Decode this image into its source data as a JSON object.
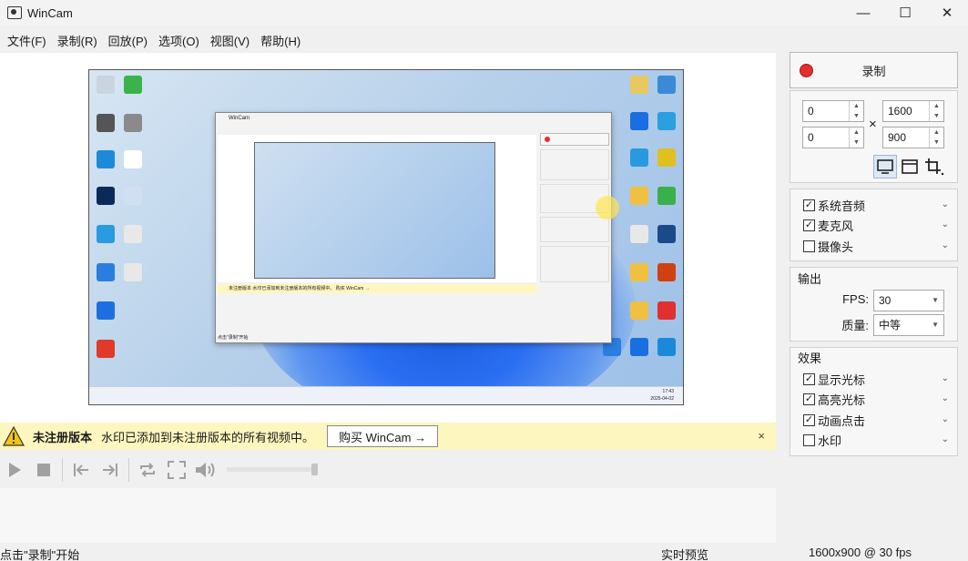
{
  "window": {
    "title": "WinCam",
    "min": "—",
    "max": "☐",
    "close": "✕"
  },
  "menu": [
    "文件(F)",
    "录制(R)",
    "回放(P)",
    "选项(O)",
    "视图(V)",
    "帮助(H)"
  ],
  "preview": {
    "inner_title": "WinCam",
    "inner_banner": "未注册版本  水印已添加到未注册版本的所有视频中。 购买 WinCam →",
    "inner_status": "点击\"录制\"开始",
    "taskbar_time": "17:43",
    "taskbar_date": "2025-04-02"
  },
  "banner": {
    "title": "未注册版本",
    "message": "水印已添加到未注册版本的所有视频中。",
    "buy_label": "购买 WinCam →",
    "close": "×"
  },
  "record": {
    "label": "录制"
  },
  "region": {
    "x": "0",
    "y": "0",
    "width": "1600",
    "height": "900",
    "times": "×"
  },
  "audio": [
    {
      "label": "系统音频",
      "checked": true
    },
    {
      "label": "麦克风",
      "checked": true
    },
    {
      "label": "摄像头",
      "checked": false
    }
  ],
  "output": {
    "title": "输出",
    "fps_label": "FPS:",
    "fps_value": "30",
    "quality_label": "质量:",
    "quality_value": "中等"
  },
  "effects": {
    "title": "效果",
    "items": [
      {
        "label": "显示光标",
        "checked": true
      },
      {
        "label": "高亮光标",
        "checked": true
      },
      {
        "label": "动画点击",
        "checked": true
      },
      {
        "label": "水印",
        "checked": false
      }
    ]
  },
  "status": {
    "left": "点击\"录制\"开始",
    "middle": "实时预览",
    "right": "1600x900 @ 30 fps"
  },
  "colors": {
    "record_dot": "#e03030",
    "banner_bg": "#fdf6bf",
    "warning": "#f0c419"
  },
  "icons": [
    "app-icon",
    "warning-icon",
    "play-icon",
    "stop-icon",
    "skip-start-icon",
    "skip-end-icon",
    "loop-icon",
    "fullscreen-icon",
    "volume-icon",
    "monitor-icon",
    "window-icon",
    "crop-icon"
  ]
}
